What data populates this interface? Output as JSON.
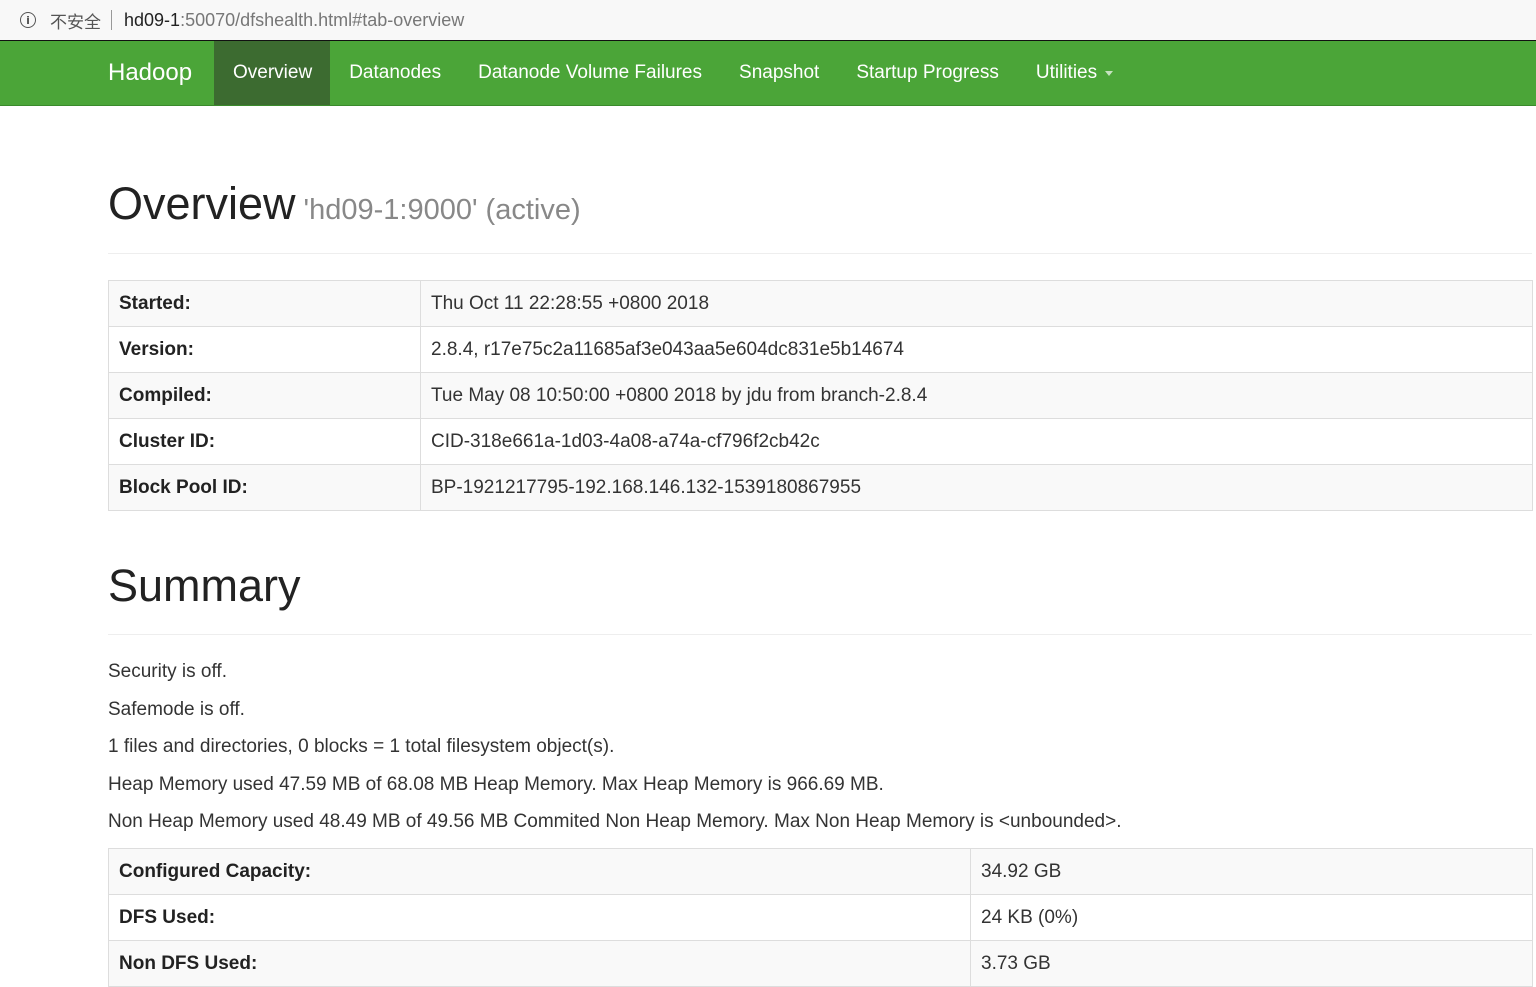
{
  "browser": {
    "insecure_label": "不安全",
    "url_host": "hd09-1",
    "url_rest": ":50070/dfshealth.html#tab-overview"
  },
  "navbar": {
    "brand": "Hadoop",
    "items": [
      {
        "label": "Overview",
        "active": true
      },
      {
        "label": "Datanodes"
      },
      {
        "label": "Datanode Volume Failures"
      },
      {
        "label": "Snapshot"
      },
      {
        "label": "Startup Progress"
      },
      {
        "label": "Utilities"
      }
    ]
  },
  "overview": {
    "title": "Overview",
    "subtitle": "'hd09-1:9000' (active)",
    "rows": [
      {
        "key": "Started:",
        "value": "Thu Oct 11 22:28:55 +0800 2018"
      },
      {
        "key": "Version:",
        "value": "2.8.4, r17e75c2a11685af3e043aa5e604dc831e5b14674"
      },
      {
        "key": "Compiled:",
        "value": "Tue May 08 10:50:00 +0800 2018 by jdu from branch-2.8.4"
      },
      {
        "key": "Cluster ID:",
        "value": "CID-318e661a-1d03-4a08-a74a-cf796f2cb42c"
      },
      {
        "key": "Block Pool ID:",
        "value": "BP-1921217795-192.168.146.132-1539180867955"
      }
    ]
  },
  "summary": {
    "title": "Summary",
    "lines": [
      "Security is off.",
      "Safemode is off.",
      "1 files and directories, 0 blocks = 1 total filesystem object(s).",
      "Heap Memory used 47.59 MB of 68.08 MB Heap Memory. Max Heap Memory is 966.69 MB.",
      "Non Heap Memory used 48.49 MB of 49.56 MB Commited Non Heap Memory. Max Non Heap Memory is <unbounded>."
    ],
    "rows": [
      {
        "key": "Configured Capacity:",
        "value": "34.92 GB"
      },
      {
        "key": "DFS Used:",
        "value": "24 KB (0%)"
      },
      {
        "key": "Non DFS Used:",
        "value": "3.73 GB"
      }
    ]
  }
}
